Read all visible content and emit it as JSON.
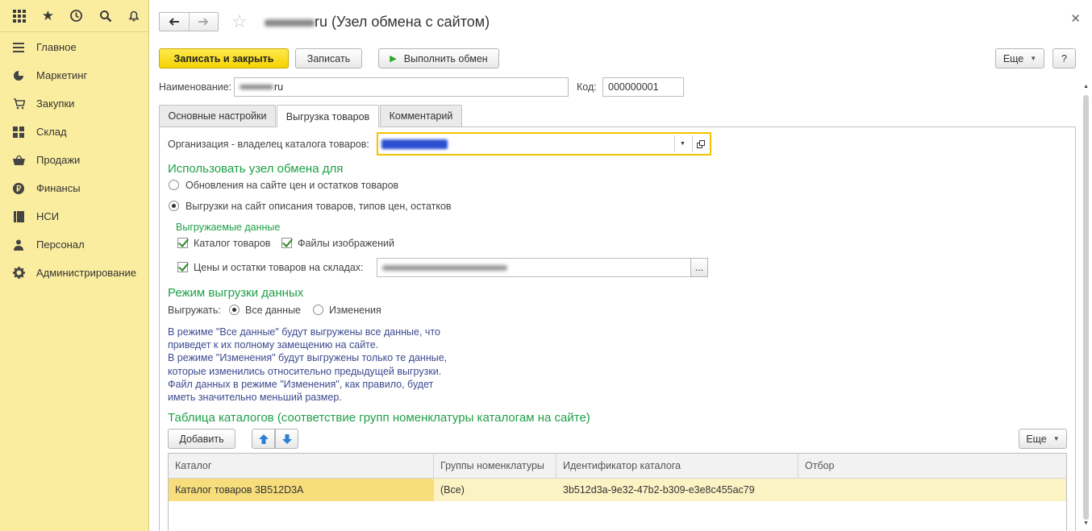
{
  "sidebar": {
    "top_icons": [
      "apps-grid-icon",
      "favorites-star-icon",
      "history-icon",
      "search-icon",
      "notifications-bell-icon"
    ],
    "items": [
      {
        "label": "Главное",
        "icon": "menu-lines-icon"
      },
      {
        "label": "Маркетинг",
        "icon": "pie-chart-icon"
      },
      {
        "label": "Закупки",
        "icon": "shopping-cart-icon"
      },
      {
        "label": "Склад",
        "icon": "warehouse-grid-icon"
      },
      {
        "label": "Продажи",
        "icon": "basket-icon"
      },
      {
        "label": "Финансы",
        "icon": "ruble-coin-icon"
      },
      {
        "label": "НСИ",
        "icon": "reference-book-icon"
      },
      {
        "label": "Персонал",
        "icon": "person-icon"
      },
      {
        "label": "Администрирование",
        "icon": "gear-icon"
      }
    ]
  },
  "header": {
    "title_suffix": "ru (Узел обмена с сайтом)",
    "back_icon": "arrow-left-icon",
    "forward_icon": "arrow-right-icon",
    "favorite_icon": "star-outline-icon",
    "close_icon": "close-icon"
  },
  "toolbar": {
    "save_close": "Записать и закрыть",
    "save": "Записать",
    "run_exchange": "Выполнить обмен",
    "more": "Еще",
    "help": "?"
  },
  "form": {
    "name_label": "Наименование:",
    "name_value_suffix": "ru",
    "code_label": "Код:",
    "code_value": "000000001"
  },
  "tabs": [
    "Основные настройки",
    "Выгрузка товаров",
    "Комментарий"
  ],
  "active_tab": 1,
  "export": {
    "org_label": "Организация - владелец каталога товаров:",
    "use_node_heading": "Использовать узел обмена для",
    "option_update": "Обновления на сайте цен и остатков товаров",
    "option_export": "Выгрузки на сайт описания товаров, типов цен, остатков",
    "exported_data_heading": "Выгружаемые данные",
    "chk_catalog": "Каталог товаров",
    "chk_images": "Файлы изображений",
    "chk_prices": "Цены и остатки товаров на складах:",
    "select_button": "...",
    "mode_heading": "Режим выгрузки данных",
    "export_label": "Выгружать:",
    "mode_all": "Все данные",
    "mode_changes": "Изменения",
    "info_lines": [
      "В режиме \"Все данные\" будут выгружены все данные, что",
      "приведет к их полному замещению на сайте.",
      "В режиме \"Изменения\" будут выгружены только те данные,",
      "которые изменились относительно предыдущей выгрузки.",
      "Файл данных в режиме \"Изменения\", как правило, будет",
      "иметь значительно меньший размер."
    ],
    "catalogs_heading": "Таблица каталогов (соответствие групп номенклатуры каталогам на сайте)",
    "add_button": "Добавить",
    "more": "Еще"
  },
  "table": {
    "columns": [
      "Каталог",
      "Группы номенклатуры",
      "Идентификатор каталога",
      "Отбор"
    ],
    "rows": [
      [
        "Каталог товаров 3B512D3A",
        "(Все)",
        "3b512d3a-9e32-47b2-b309-e3e8c455ac79",
        ""
      ]
    ]
  },
  "colors": {
    "sidebar_bg": "#fbeda0",
    "primary_button": "#f5d300",
    "section_heading": "#1f9f47",
    "info_text": "#3c4a8f",
    "selected_row": "#fcf3c4"
  }
}
